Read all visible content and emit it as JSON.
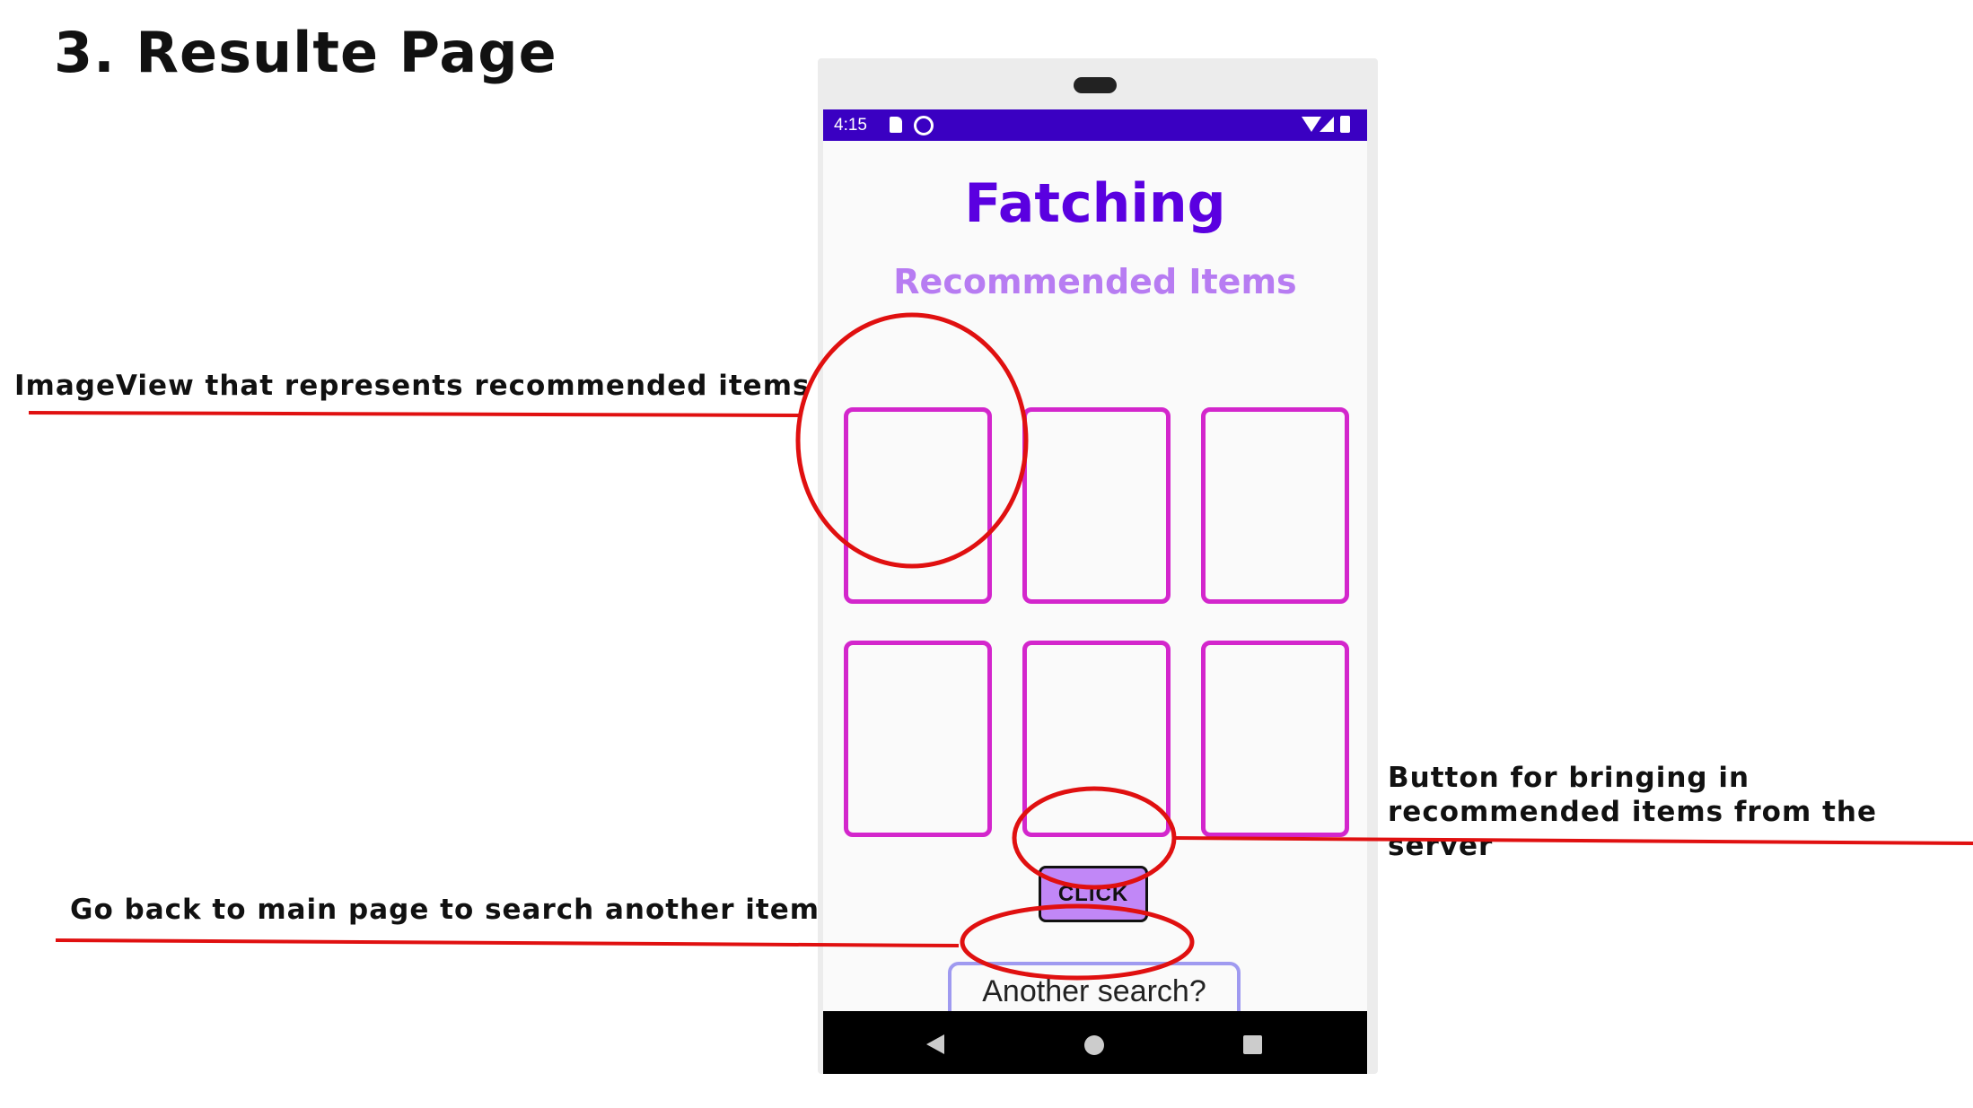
{
  "slide": {
    "title": "3. Resulte Page"
  },
  "annotations": {
    "imageview": "ImageView that represents recommended items",
    "click_button": "Button for bringing in recommended items from the server",
    "go_back": "Go back to main page to search another item"
  },
  "app": {
    "status_bar": {
      "time": "4:15",
      "icons": [
        "sd-card-icon",
        "sync-icon",
        "wifi-icon",
        "signal-icon",
        "battery-icon"
      ]
    },
    "title": "Fatching",
    "section_title": "Recommended Items",
    "image_slots": 6,
    "click_button_label": "CLICK",
    "another_search_label": "Another search?",
    "nav_icons": [
      "back-icon",
      "home-icon",
      "recents-icon"
    ]
  },
  "colors": {
    "status_bar": "#3a00c2",
    "app_title": "#5a00e0",
    "section_title": "#b77cf2",
    "slot_border": "#d326cc",
    "click_button_bg": "#c187f7",
    "another_search_border": "#9f9af0",
    "annotation_red": "#e01010"
  }
}
